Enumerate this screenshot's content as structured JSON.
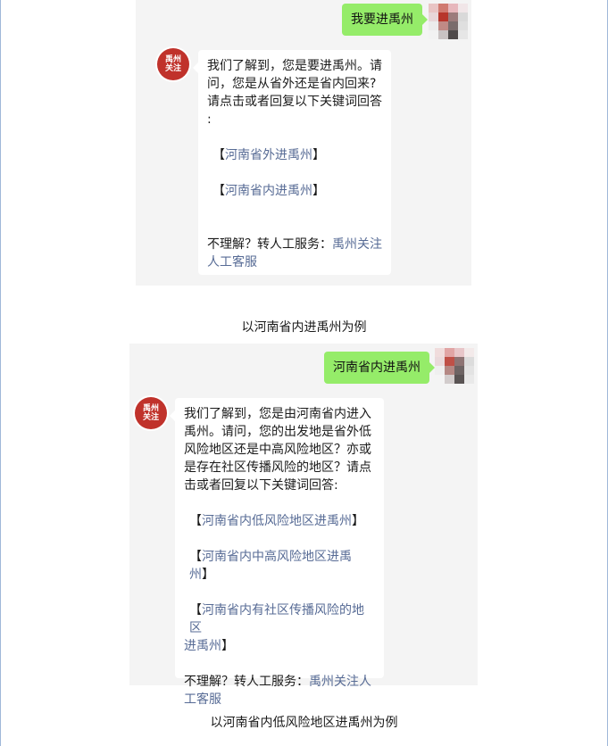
{
  "chat1": {
    "user_message": "我要进禹州",
    "bot_message": {
      "intro_lines": [
        "我们了解到，您是要进禹州。请",
        "问，您是从省外还是省内回来?",
        "请点击或者回复以下关键词回答",
        ":"
      ],
      "keywords": [
        {
          "open": "【",
          "text": "河南省外进禹州",
          "close": "】"
        },
        {
          "open": "【",
          "text": "河南省内进禹州",
          "close": "】"
        }
      ],
      "service_prefix": "不理解？转人工服务：",
      "service_link_line1": "禹州关注",
      "service_link_line2": "人工客服"
    },
    "bot_avatar_text": [
      "禹州",
      "关注"
    ]
  },
  "caption1": "以河南省内进禹州为例",
  "chat2": {
    "user_message": "河南省内进禹州",
    "bot_message": {
      "intro_lines": [
        "我们了解到，您是由河南省内进入",
        "禹州。请问，您的出发地是省外低",
        "风险地区还是中高风险地区？亦或",
        "是存在社区传播风险的地区？请点",
        "击或者回复以下关键词回答:"
      ],
      "keywords": [
        {
          "open": "【",
          "text": "河南省内低风险地区进禹州",
          "close": "】"
        },
        {
          "open": "【",
          "text": "河南省内中高风险地区进禹州",
          "close": "】"
        },
        {
          "open": "【",
          "text": "河南省内有社区传播风险的地区",
          "text2": "进禹州",
          "close": "】"
        }
      ],
      "service_prefix": "不理解？转人工服务：",
      "service_link_line1": "禹州关注人",
      "service_link_line2": "工客服"
    },
    "bot_avatar_text": [
      "禹州",
      "关注"
    ]
  },
  "caption2": "以河南省内低风险地区进禹州为例",
  "colors": {
    "user_bubble": "#95ec69",
    "link": "#576b95",
    "bot_avatar": "#c0322b",
    "chat_background": "#f4f4f4"
  }
}
